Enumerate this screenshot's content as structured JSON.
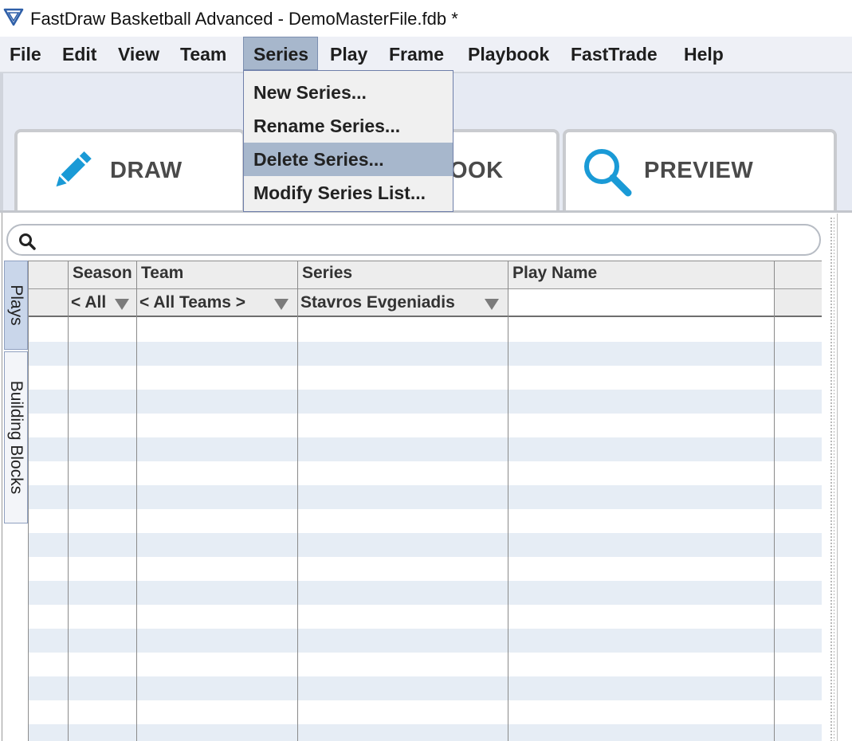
{
  "window": {
    "title": "FastDraw Basketball Advanced - DemoMasterFile.fdb *",
    "icon": "fastdraw-logo-icon"
  },
  "menubar": {
    "items": [
      "File",
      "Edit",
      "View",
      "Team",
      "Series",
      "Play",
      "Frame",
      "Playbook",
      "FastTrade",
      "Help"
    ],
    "active": "Series"
  },
  "series_menu": {
    "items": [
      "New Series...",
      "Rename Series...",
      "Delete Series...",
      "Modify Series List..."
    ],
    "highlighted": "Delete Series..."
  },
  "mode_tabs": [
    {
      "label": "DRAW",
      "icon": "pencil-icon"
    },
    {
      "label": "PLAYBOOK",
      "visible_label": "OOK",
      "icon": "book-icon"
    },
    {
      "label": "PREVIEW",
      "icon": "magnifier-icon"
    }
  ],
  "search": {
    "value": "",
    "placeholder": "",
    "icon": "search-icon"
  },
  "side_tabs": [
    {
      "label": "Plays",
      "selected": true
    },
    {
      "label": "Building Blocks",
      "selected": false
    }
  ],
  "table": {
    "columns": [
      "",
      "Season",
      "Team",
      "Series",
      "Play Name",
      ""
    ],
    "filters": {
      "season": "< All",
      "team": "< All Teams >",
      "series": "Stavros Evgeniadis",
      "play_name": ""
    },
    "rows": []
  },
  "colors": {
    "menu_highlight": "#a7b7cc",
    "stripe": "#e6edf5",
    "accent_blue": "#1a9ad6"
  }
}
